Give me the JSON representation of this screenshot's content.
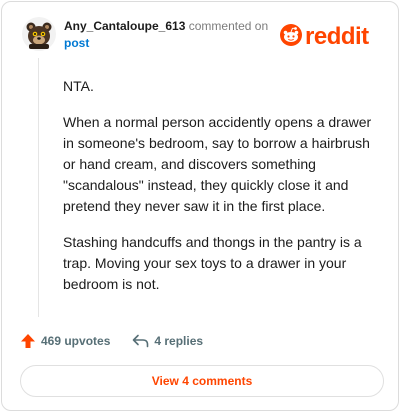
{
  "header": {
    "author": "Any_Cantaloupe_613",
    "commented_on": "commented on",
    "post_link": "post",
    "brand": "reddit"
  },
  "comment": {
    "paragraphs": [
      "NTA.",
      "When a normal person accidently opens a drawer in someone's bedroom, say to borrow a hairbrush or hand cream, and discovers something \"scandalous\" instead, they quickly close it and pretend they never saw it in the first place.",
      "Stashing handcuffs and thongs in the pantry is a trap. Moving your sex toys to a drawer in your bedroom is not."
    ]
  },
  "actions": {
    "upvotes": "469 upvotes",
    "replies": "4 replies"
  },
  "footer": {
    "view_comments": "View 4 comments"
  },
  "colors": {
    "accent": "#ff4500",
    "link": "#0079d3",
    "muted": "#7c7c7c"
  },
  "icons": {
    "avatar": "snoo-avatar-icon",
    "brand": "reddit-snoo-icon",
    "upvote": "upvote-arrow-icon",
    "reply": "reply-arrow-icon"
  }
}
